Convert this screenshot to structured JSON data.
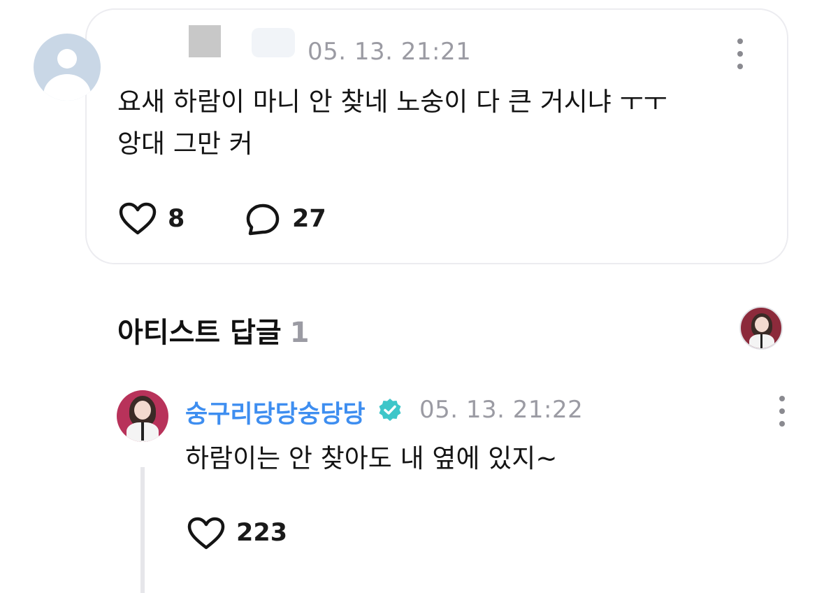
{
  "fan_post": {
    "date": "05. 13. 21:21",
    "lines": [
      "요새 하람이 마니 안 찾네 노숭이 다 큰 거시냐 ㅜㅜ",
      "앙대 그만 커"
    ],
    "like_count": "8",
    "comment_count": "27"
  },
  "artist_reply": {
    "section_title": "아티스트 답글",
    "section_count": "1",
    "name": "숭구리당당숭당당",
    "date": "05. 13. 21:22",
    "text": "하람이는 안 찾아도 내 옆에 있지~",
    "like_count": "223"
  },
  "colors": {
    "artist_name": "#3e8ef0",
    "verified_badge": "#3ec6c9",
    "muted_text": "#9b9ba3",
    "card_border": "#ececf0"
  },
  "icons": [
    "user-avatar-icon",
    "more-vertical-icon",
    "heart-icon",
    "comment-bubble-icon",
    "verified-badge-icon"
  ]
}
